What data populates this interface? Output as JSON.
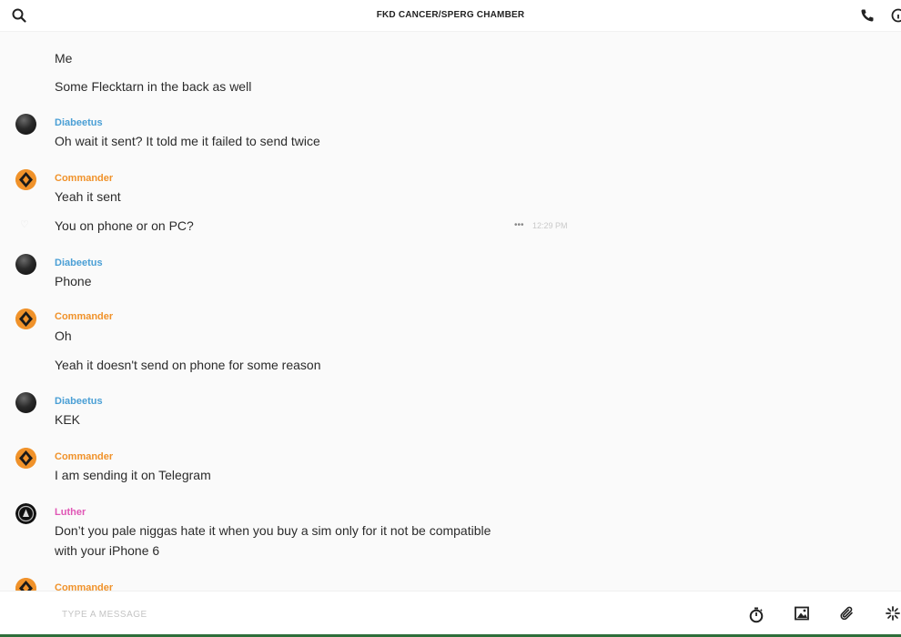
{
  "header": {
    "title": "FKD CANCER/SPERG CHAMBER",
    "icons": [
      "search-icon",
      "phone-icon",
      "info-icon"
    ]
  },
  "messages": [
    {
      "id": "m1",
      "author": "Me",
      "text": "",
      "avatar": ""
    },
    {
      "id": "m2",
      "author": "",
      "text": "Some Flecktarn in the back as well"
    },
    {
      "id": "m3",
      "author": "Diabeetus",
      "text": "Oh wait it sent? It told me it failed to send twice"
    },
    {
      "id": "m4",
      "author": "Commander",
      "text": "Yeah it sent"
    },
    {
      "id": "m5",
      "author": "",
      "text": "You on phone or on PC?",
      "time": "12:29 PM",
      "more": "•••"
    },
    {
      "id": "m6",
      "author": "Diabeetus",
      "text": "Phone"
    },
    {
      "id": "m7",
      "author": "Commander",
      "text": "Oh"
    },
    {
      "id": "m8",
      "author": "",
      "text": "Yeah it doesn't send on phone for some reason"
    },
    {
      "id": "m9",
      "author": "Diabeetus",
      "text": "KEK"
    },
    {
      "id": "m10",
      "author": "Commander",
      "text": "I am sending it on Telegram"
    },
    {
      "id": "m11",
      "author": "Luther",
      "text": "Don’t you pale niggas hate it when you buy a sim only for it not be compatible with your iPhone 6"
    },
    {
      "id": "m12",
      "author": "Commander",
      "text": ""
    }
  ],
  "composer": {
    "placeholder": "TYPE A MESSAGE",
    "icons": [
      "timer-icon",
      "image-icon",
      "paperclip-icon",
      "sparkle-icon"
    ]
  },
  "colors": {
    "diabeetus": "#4a9fd5",
    "commander": "#f0922a",
    "luther": "#e056b5"
  }
}
